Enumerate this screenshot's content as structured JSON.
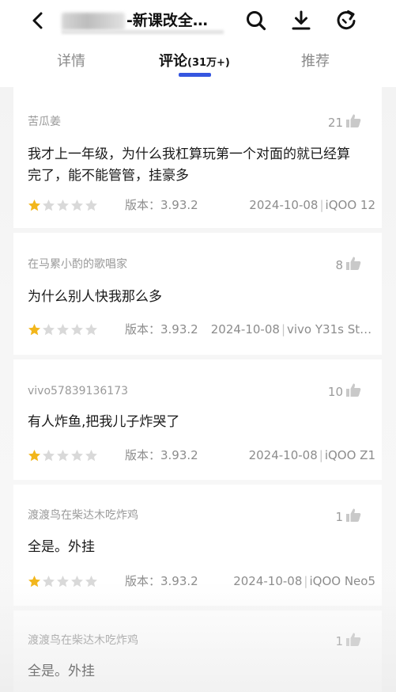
{
  "header": {
    "title": "-新课改全…",
    "icons": [
      "back-arrow-icon",
      "search-icon",
      "download-icon",
      "refresh-icon"
    ]
  },
  "tabs": [
    {
      "label": "详情",
      "count": "",
      "active": false
    },
    {
      "label": "评论",
      "count": "(31万+)",
      "active": true
    },
    {
      "label": "推荐",
      "count": "",
      "active": false
    }
  ],
  "colors": {
    "accent": "#3556e0",
    "star_on": "#f2b61b",
    "star_off": "#d9d9d9"
  },
  "comments": [
    {
      "user": "苦瓜姜",
      "likes": "21",
      "text": "我才上一年级，为什么我杠算玩第一个对面的就已经算完了，能不能管管，挂豪多",
      "rating": 1,
      "version": "版本：3.93.2",
      "date": "2024-10-08",
      "device": "iQOO 12"
    },
    {
      "user": "在马累小酌的歌唱家",
      "likes": "8",
      "text": "为什么别人快我那么多",
      "rating": 1,
      "version": "版本：3.93.2",
      "date": "2024-10-08",
      "device": "vivo Y31s Sta…"
    },
    {
      "user": "vivo57839136173",
      "likes": "10",
      "text": "有人炸鱼,把我儿子炸哭了",
      "rating": 1,
      "version": "版本：3.93.2",
      "date": "2024-10-08",
      "device": "iQOO Z1"
    },
    {
      "user": "渡渡鸟在柴达木吃炸鸡",
      "likes": "1",
      "text": "全是。外挂",
      "rating": 1,
      "version": "版本：3.93.2",
      "date": "2024-10-08",
      "device": "iQOO Neo5"
    },
    {
      "user": "渡渡鸟在柴达木吃炸鸡",
      "likes": "1",
      "text": "全是。外挂",
      "rating": 0,
      "version": "",
      "date": "",
      "device": ""
    }
  ]
}
